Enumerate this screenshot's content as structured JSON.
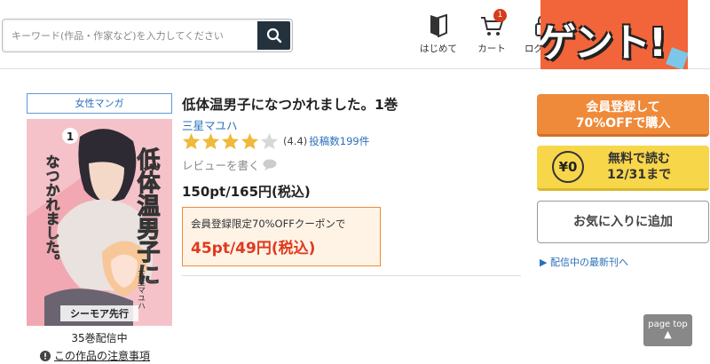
{
  "header": {
    "search_placeholder": "キーワード(作品・作家など)を入力してください",
    "nav": [
      {
        "label": "はじめて",
        "icon": "book-icon"
      },
      {
        "label": "カート",
        "icon": "cart-icon",
        "badge": "1"
      },
      {
        "label": "ログイン",
        "icon": "lock-icon"
      }
    ],
    "banner_text": "ゲント!"
  },
  "book": {
    "genre": "女性マンガ",
    "title": "低体温男子になつかれました。1巻",
    "author": "三星マユハ",
    "rating_value": 4.4,
    "rating_text": "(4.4)",
    "review_count": "投稿数199件",
    "write_review": "レビューを書く",
    "price": "150pt/165円(税込)",
    "coupon_label": "会員登録限定70%OFFクーポンで",
    "coupon_price": "45pt/49円(税込)",
    "volumes": "35巻配信中",
    "notice": "この作品の注意事項",
    "cover": {
      "title": "低体温男子に",
      "subtitle": "なつかれました。",
      "volume_number": "1",
      "author": "三星マユハ",
      "label": "シーモア先行"
    }
  },
  "actions": {
    "register_line1": "会員登録して",
    "register_line2": "70%OFFで購入",
    "free_coin": "¥0",
    "free_line1": "無料で読む",
    "free_line2": "12/31まで",
    "favorite": "お気に入りに追加",
    "latest": "▶ 配信中の最新刊へ"
  },
  "page_top": {
    "line1": "page top",
    "arrow": "▲"
  },
  "colors": {
    "accent_orange": "#ef8a3a",
    "accent_yellow": "#f8d64a",
    "link_blue": "#2a6fba",
    "price_red": "#e03a1e"
  }
}
